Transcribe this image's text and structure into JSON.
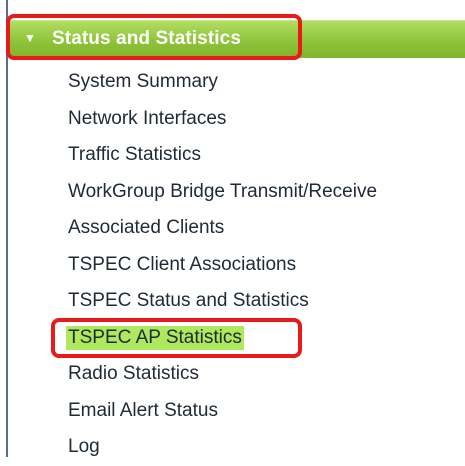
{
  "section": {
    "title": "Status and Statistics",
    "expanded_arrow": "▼"
  },
  "menu": {
    "items": [
      {
        "label": "System Summary"
      },
      {
        "label": "Network Interfaces"
      },
      {
        "label": "Traffic Statistics"
      },
      {
        "label": "WorkGroup Bridge Transmit/Receive"
      },
      {
        "label": "Associated Clients"
      },
      {
        "label": "TSPEC Client Associations"
      },
      {
        "label": "TSPEC Status and Statistics"
      },
      {
        "label": "TSPEC AP Statistics",
        "selected": true
      },
      {
        "label": "Radio Statistics"
      },
      {
        "label": "Email Alert Status"
      },
      {
        "label": "Log"
      }
    ]
  },
  "colors": {
    "header_green": "#8fc33a",
    "selected_bg": "#aee85d",
    "callout_red": "#e81a1a"
  }
}
